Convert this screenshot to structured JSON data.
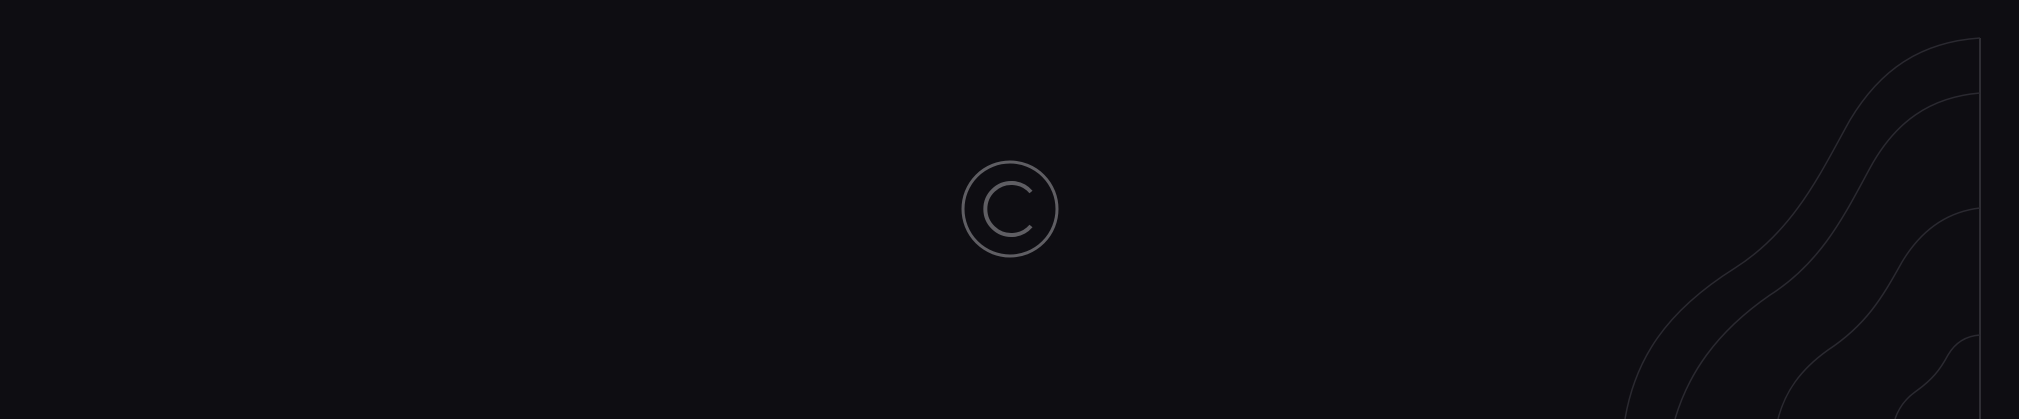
{
  "page": {
    "background_color": "#0e0d12"
  },
  "copyright_icon": {
    "icon": "copyright-icon",
    "color": "#5f5e63"
  },
  "decoration": {
    "icon": "wave-lines-decoration",
    "line_color": "#2a2930",
    "edge_line_color": "#3a3940"
  }
}
